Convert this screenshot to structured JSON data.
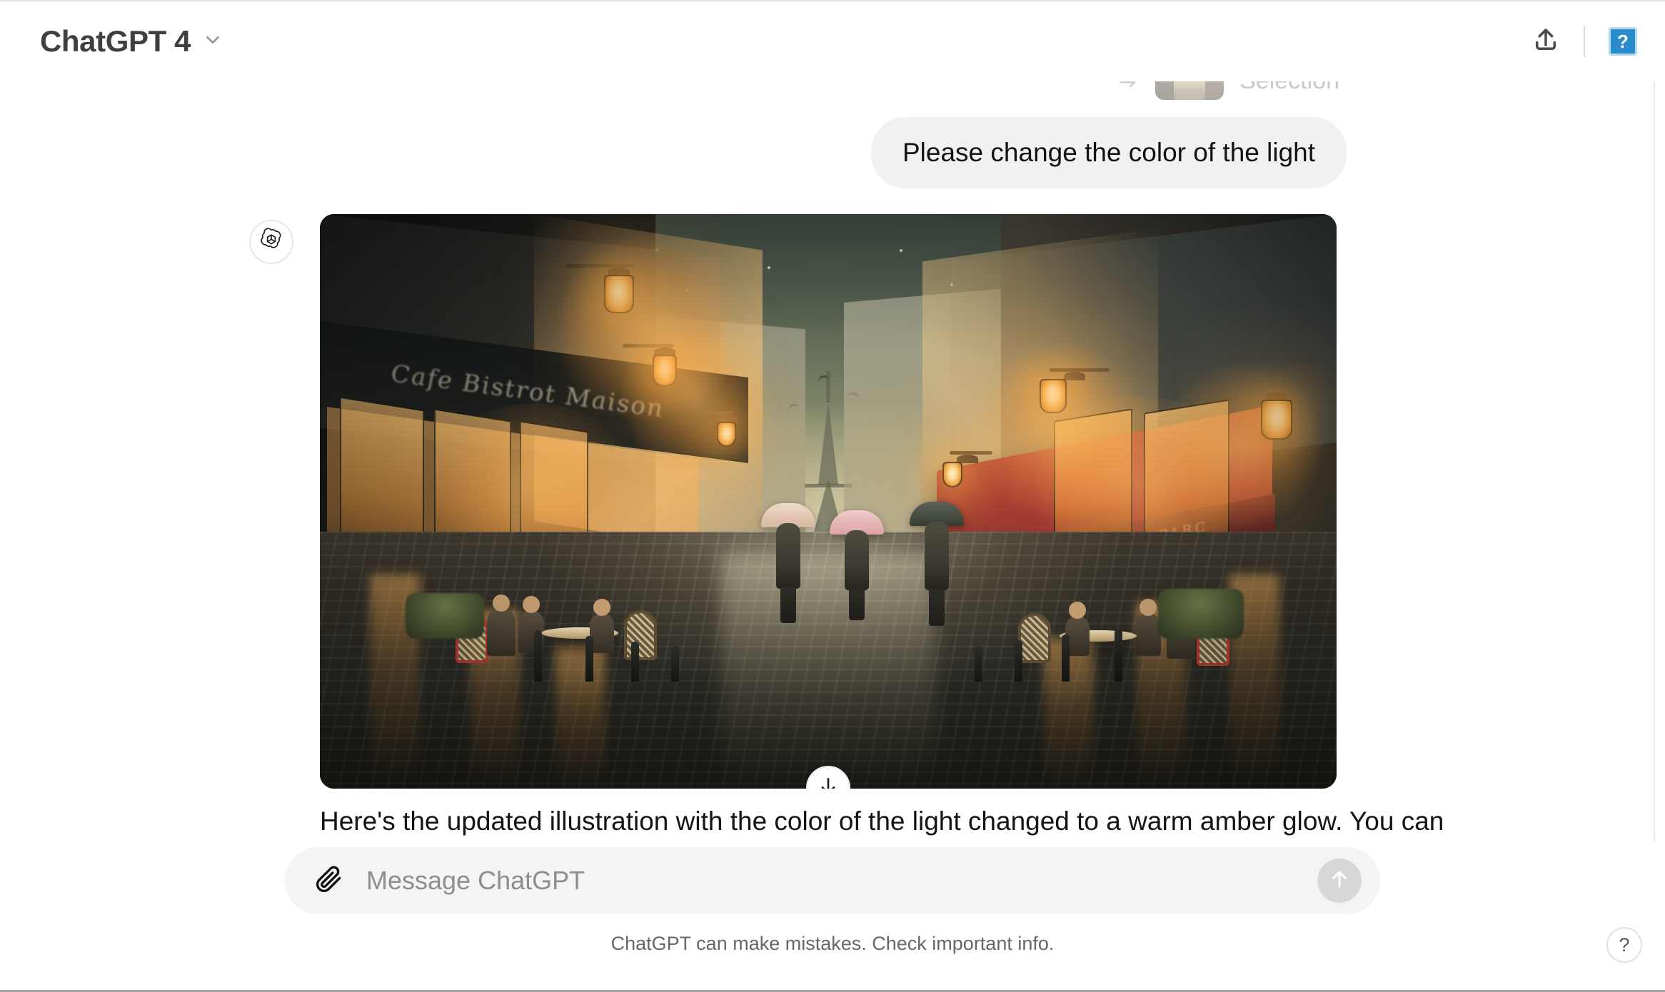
{
  "header": {
    "model_title": "ChatGPT 4",
    "model_dropdown_icon": "chevron-down-icon",
    "share_icon": "share-upload-icon",
    "help_badge_icon": "question-mark-icon",
    "help_badge_label": "?",
    "help_badge_color": "#2b8ccd"
  },
  "conversation": {
    "selection_ref": {
      "arrow_icon": "reply-arrow-icon",
      "label": "Selection",
      "thumbnail_alt": "parisian-street-thumbnail"
    },
    "user_message": {
      "text": "Please change the color of the light",
      "bubble_color": "#f1f1f1"
    },
    "assistant_message": {
      "avatar_icon": "openai-logo-icon",
      "text": "Here's the updated illustration with the color of the light changed to a warm amber glow. You can",
      "image_alt": "parisian-street-at-dusk-with-eiffel-tower"
    },
    "scroll_down_icon": "arrow-down-icon"
  },
  "illustration": {
    "title": "Parisian street at dusk with warm amber lamplight",
    "sky_top_color": "#3f4a41",
    "sky_glow_color": "#e3d7ad",
    "lamp_glow_color": "#ffb24a",
    "awning_color": "#b8412f",
    "street_color": "#30302a",
    "left_sign_text": "Cafe Bistrot Maison",
    "right_awning_text": "BRASSERIE DU PARC",
    "pedestrian_count": 3,
    "umbrella_colors": [
      "#e8c9b8",
      "#e4b4b4",
      "#4c5348"
    ]
  },
  "composer": {
    "attach_icon": "paperclip-icon",
    "placeholder": "Message ChatGPT",
    "value": "",
    "send_icon": "arrow-up-icon",
    "send_enabled": false
  },
  "footer": {
    "disclaimer": "ChatGPT can make mistakes. Check important info.",
    "help_fab_label": "?"
  }
}
